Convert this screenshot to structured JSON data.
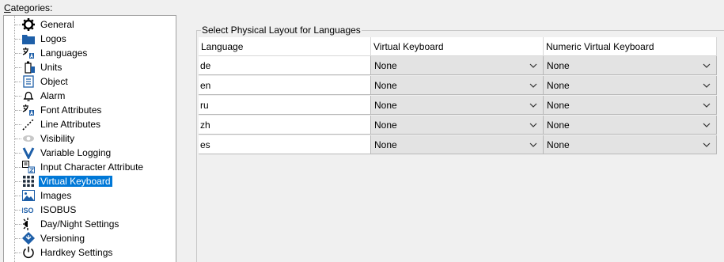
{
  "categories_label": "Categories:",
  "categories_underline": "C",
  "categories_rest": "ategories:",
  "tree": {
    "items": [
      {
        "label": "General",
        "icon": "gear-icon"
      },
      {
        "label": "Logos",
        "icon": "folder-icon"
      },
      {
        "label": "Languages",
        "icon": "language-icon"
      },
      {
        "label": "Units",
        "icon": "units-icon"
      },
      {
        "label": "Object",
        "icon": "object-icon"
      },
      {
        "label": "Alarm",
        "icon": "bell-icon"
      },
      {
        "label": "Font Attributes",
        "icon": "font-icon"
      },
      {
        "label": "Line Attributes",
        "icon": "line-icon"
      },
      {
        "label": "Visibility",
        "icon": "eye-icon"
      },
      {
        "label": "Variable Logging",
        "icon": "variable-logging-icon"
      },
      {
        "label": "Input Character Attribute",
        "icon": "input-character-icon"
      },
      {
        "label": "Virtual Keyboard",
        "icon": "keyboard-icon",
        "selected": true
      },
      {
        "label": "Images",
        "icon": "image-icon"
      },
      {
        "label": "ISOBUS",
        "icon": "isobus-icon"
      },
      {
        "label": "Day/Night Settings",
        "icon": "day-night-icon"
      },
      {
        "label": "Versioning",
        "icon": "versioning-icon"
      },
      {
        "label": "Hardkey Settings",
        "icon": "power-icon"
      }
    ]
  },
  "group": {
    "title": "Select Physical Layout for Languages",
    "columns": [
      "Language",
      "Virtual Keyboard",
      "Numeric Virtual Keyboard"
    ],
    "rows": [
      {
        "language": "de",
        "virtual": "None",
        "numeric": "None"
      },
      {
        "language": "en",
        "virtual": "None",
        "numeric": "None"
      },
      {
        "language": "ru",
        "virtual": "None",
        "numeric": "None"
      },
      {
        "language": "zh",
        "virtual": "None",
        "numeric": "None"
      },
      {
        "language": "es",
        "virtual": "None",
        "numeric": "None"
      }
    ]
  },
  "colors": {
    "selection": "#0078d7",
    "icon_blue": "#1e5fa8",
    "combo_bg": "#e3e3e3"
  }
}
